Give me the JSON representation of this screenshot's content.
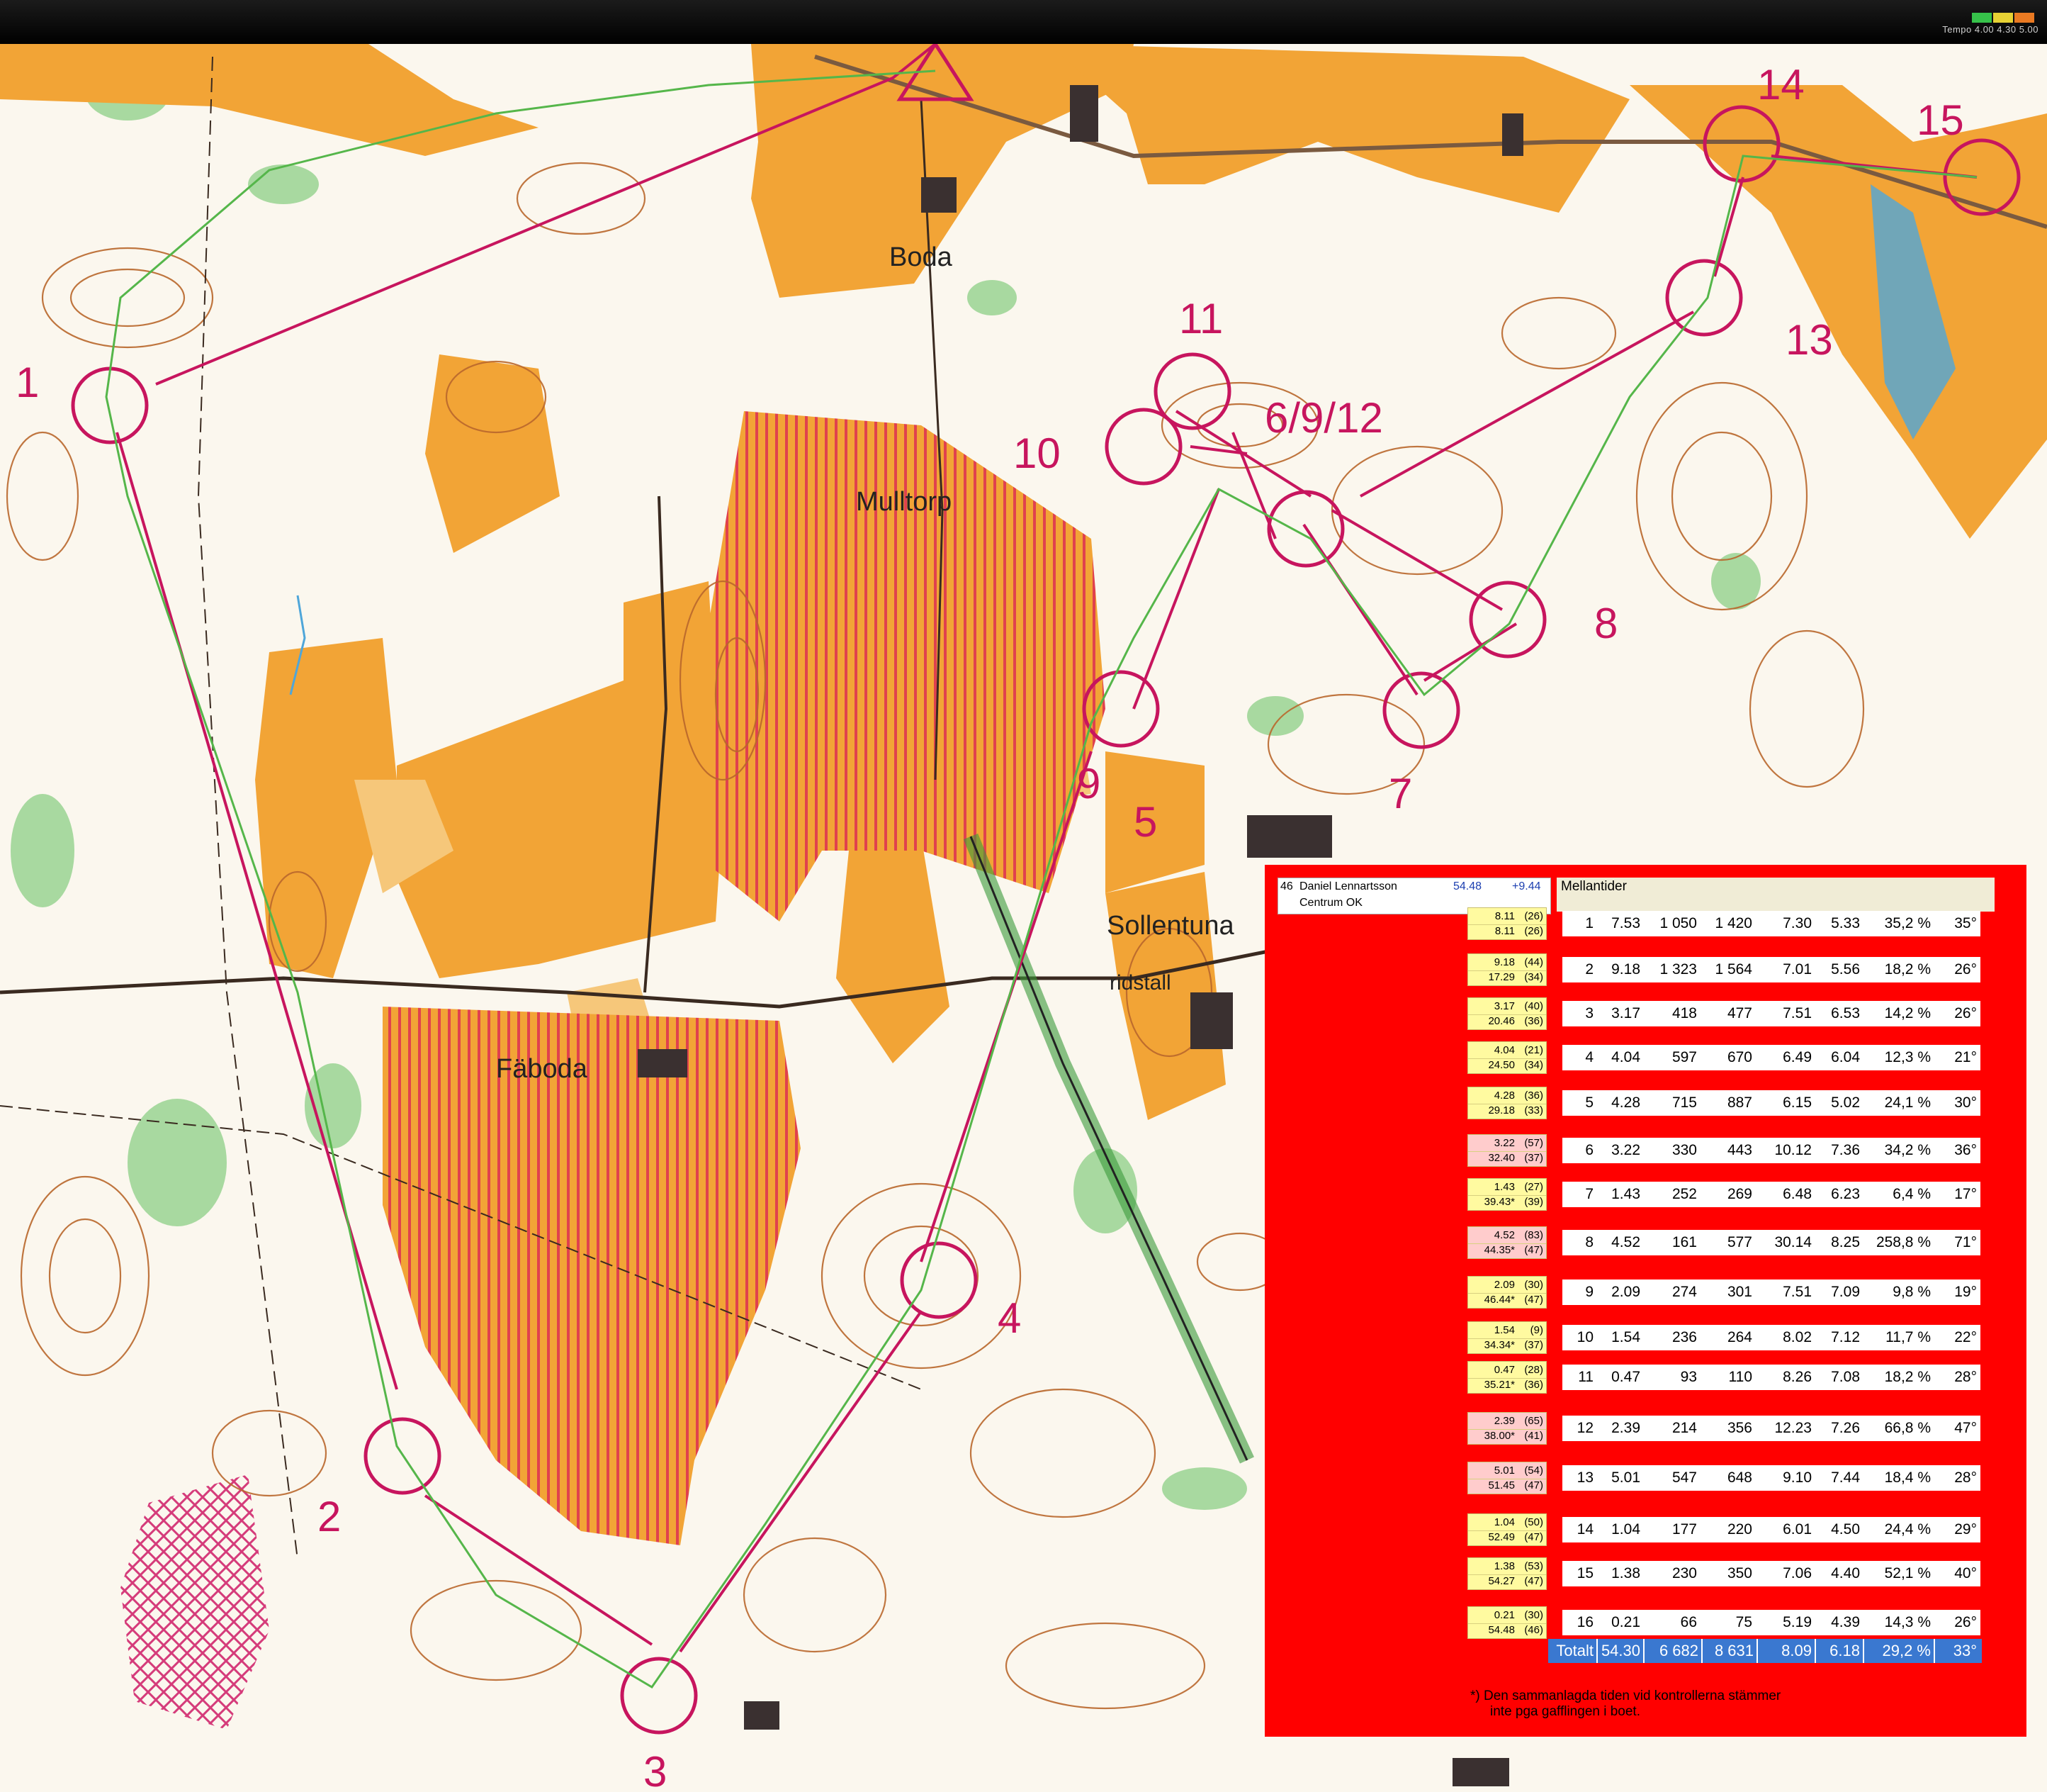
{
  "tempo": {
    "label": "Tempo 4.00  4.30  5.00",
    "bar_colors": [
      "#36c24a",
      "#e7d234",
      "#ea7a22"
    ]
  },
  "map": {
    "place_names": [
      "Boda",
      "Mulltorp",
      "Fäboda",
      "Sollentuna",
      "ridstall"
    ],
    "control_labels": [
      "1",
      "2",
      "3",
      "4",
      "5",
      "6/9/12",
      "7",
      "8",
      "9",
      "10",
      "11",
      "13",
      "14",
      "15"
    ],
    "colors": {
      "paper": "#fbf7ee",
      "open_land": "#f2a436",
      "rough_open": "#f6c77a",
      "forbidden": "#e64a52",
      "course": "#c7155e",
      "contour": "#b9672c",
      "green": "#8ccf86",
      "water": "#4fa6d9"
    }
  },
  "runner": {
    "number": "46",
    "name": "Daniel Lennartsson",
    "club": "Centrum OK",
    "time": "54.48",
    "behind": "+9.44"
  },
  "splits": {
    "title": "Mellantider",
    "cumulative": [
      {
        "leg": "8.11",
        "leg_place": "(26)",
        "total": "8.11",
        "total_place": "(26)",
        "highlight": false
      },
      {
        "leg": "9.18",
        "leg_place": "(44)",
        "total": "17.29",
        "total_place": "(34)",
        "highlight": false
      },
      {
        "leg": "3.17",
        "leg_place": "(40)",
        "total": "20.46",
        "total_place": "(36)",
        "highlight": false
      },
      {
        "leg": "4.04",
        "leg_place": "(21)",
        "total": "24.50",
        "total_place": "(34)",
        "highlight": false
      },
      {
        "leg": "4.28",
        "leg_place": "(36)",
        "total": "29.18",
        "total_place": "(33)",
        "highlight": false
      },
      {
        "leg": "3.22",
        "leg_place": "(57)",
        "total": "32.40",
        "total_place": "(37)",
        "highlight": true
      },
      {
        "leg": "1.43",
        "leg_place": "(27)",
        "total": "39.43*",
        "total_place": "(39)",
        "highlight": false
      },
      {
        "leg": "4.52",
        "leg_place": "(83)",
        "total": "44.35*",
        "total_place": "(47)",
        "highlight": true
      },
      {
        "leg": "2.09",
        "leg_place": "(30)",
        "total": "46.44*",
        "total_place": "(47)",
        "highlight": false
      },
      {
        "leg": "1.54",
        "leg_place": "(9)",
        "total": "34.34*",
        "total_place": "(37)",
        "highlight": false
      },
      {
        "leg": "0.47",
        "leg_place": "(28)",
        "total": "35.21*",
        "total_place": "(36)",
        "highlight": false
      },
      {
        "leg": "2.39",
        "leg_place": "(65)",
        "total": "38.00*",
        "total_place": "(41)",
        "highlight": true
      },
      {
        "leg": "5.01",
        "leg_place": "(54)",
        "total": "51.45",
        "total_place": "(47)",
        "highlight": true
      },
      {
        "leg": "1.04",
        "leg_place": "(50)",
        "total": "52.49",
        "total_place": "(47)",
        "highlight": false
      },
      {
        "leg": "1.38",
        "leg_place": "(53)",
        "total": "54.27",
        "total_place": "(47)",
        "highlight": false
      },
      {
        "leg": "0.21",
        "leg_place": "(30)",
        "total": "54.48",
        "total_place": "(46)",
        "highlight": false
      }
    ],
    "legs": [
      [
        "1",
        "7.53",
        "1 050",
        "1 420",
        "7.30",
        "5.33",
        "35,2 %",
        "35°"
      ],
      [
        "2",
        "9.18",
        "1 323",
        "1 564",
        "7.01",
        "5.56",
        "18,2 %",
        "26°"
      ],
      [
        "3",
        "3.17",
        "418",
        "477",
        "7.51",
        "6.53",
        "14,2 %",
        "26°"
      ],
      [
        "4",
        "4.04",
        "597",
        "670",
        "6.49",
        "6.04",
        "12,3 %",
        "21°"
      ],
      [
        "5",
        "4.28",
        "715",
        "887",
        "6.15",
        "5.02",
        "24,1 %",
        "30°"
      ],
      [
        "6",
        "3.22",
        "330",
        "443",
        "10.12",
        "7.36",
        "34,2 %",
        "36°"
      ],
      [
        "7",
        "1.43",
        "252",
        "269",
        "6.48",
        "6.23",
        "6,4 %",
        "17°"
      ],
      [
        "8",
        "4.52",
        "161",
        "577",
        "30.14",
        "8.25",
        "258,8 %",
        "71°"
      ],
      [
        "9",
        "2.09",
        "274",
        "301",
        "7.51",
        "7.09",
        "9,8 %",
        "19°"
      ],
      [
        "10",
        "1.54",
        "236",
        "264",
        "8.02",
        "7.12",
        "11,7 %",
        "22°"
      ],
      [
        "11",
        "0.47",
        "93",
        "110",
        "8.26",
        "7.08",
        "18,2 %",
        "28°"
      ],
      [
        "12",
        "2.39",
        "214",
        "356",
        "12.23",
        "7.26",
        "66,8 %",
        "47°"
      ],
      [
        "13",
        "5.01",
        "547",
        "648",
        "9.10",
        "7.44",
        "18,4 %",
        "28°"
      ],
      [
        "14",
        "1.04",
        "177",
        "220",
        "6.01",
        "4.50",
        "24,4 %",
        "29°"
      ],
      [
        "15",
        "1.38",
        "230",
        "350",
        "7.06",
        "4.40",
        "52,1 %",
        "40°"
      ],
      [
        "16",
        "0.21",
        "66",
        "75",
        "5.19",
        "4.39",
        "14,3 %",
        "26°"
      ]
    ],
    "total": [
      "Totalt",
      "54.30",
      "6 682",
      "8 631",
      "8.09",
      "6.18",
      "29,2 %",
      "33°"
    ],
    "total_bg": "#3a78d0"
  },
  "footnote": {
    "line1": "*) Den sammanlagda tiden vid kontrollerna stämmer",
    "line2": "inte pga gafflingen i boet."
  }
}
